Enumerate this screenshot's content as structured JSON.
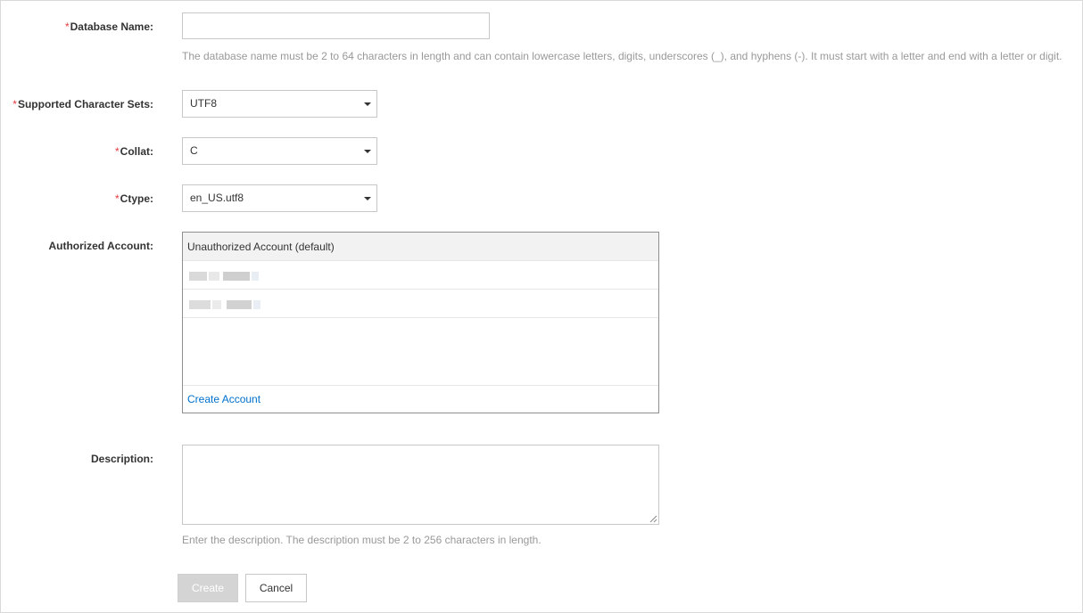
{
  "form": {
    "required_mark": "*",
    "database_name": {
      "label": "Database Name:",
      "value": "",
      "hint": "The database name must be 2 to 64 characters in length and can contain lowercase letters, digits, underscores (_), and hyphens (-). It must start with a letter and end with a letter or digit."
    },
    "charset": {
      "label": "Supported Character Sets:",
      "value": "UTF8"
    },
    "collat": {
      "label": "Collat:",
      "value": "C"
    },
    "ctype": {
      "label": "Ctype:",
      "value": "en_US.utf8"
    },
    "authorized_account": {
      "label": "Authorized Account:",
      "default_option": "Unauthorized Account (default)",
      "create_link": "Create Account"
    },
    "description": {
      "label": "Description:",
      "value": "",
      "hint": "Enter the description. The description must be 2 to 256 characters in length."
    }
  },
  "buttons": {
    "create": "Create",
    "cancel": "Cancel"
  },
  "colors": {
    "required": "#e4393c",
    "link": "#0070cc",
    "hint": "#999999",
    "disabled_button": "#d4d4d4"
  }
}
